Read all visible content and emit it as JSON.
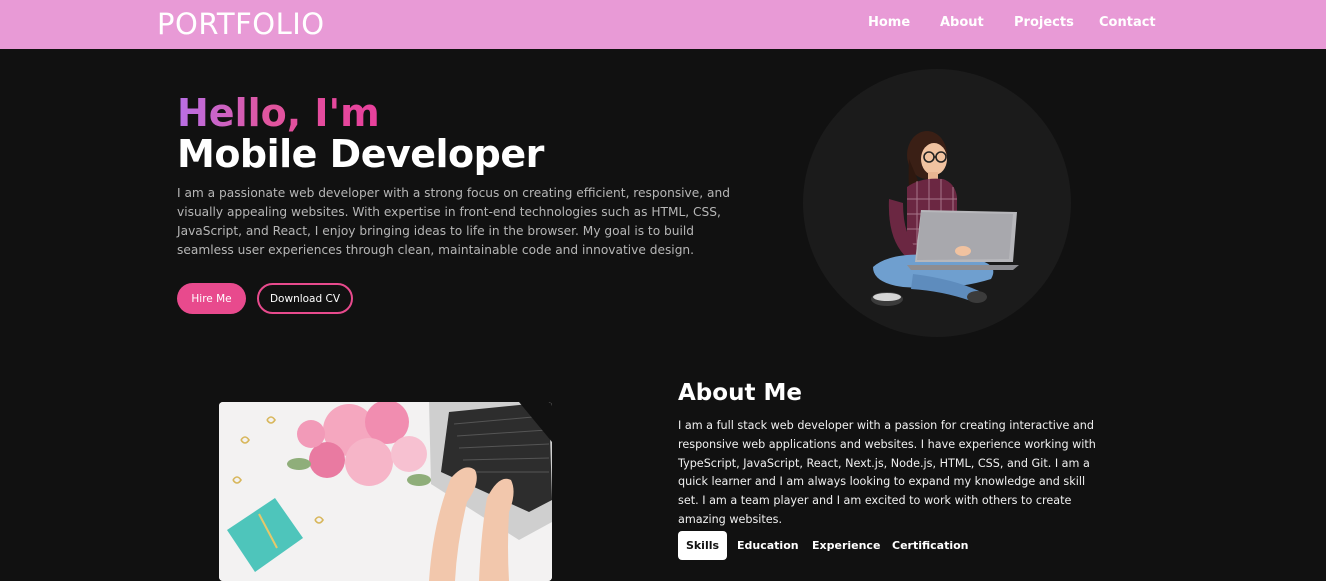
{
  "nav": {
    "logo": "PORTFOLIO",
    "links": [
      "Home",
      "About",
      "Projects",
      "Contact"
    ]
  },
  "hero": {
    "greeting": "Hello, I'm",
    "role": "Mobile Developer",
    "description": "I am a passionate web developer with a strong focus on creating efficient, responsive, and visually appealing websites. With expertise in front-end technologies such as HTML, CSS, JavaScript, and React, I enjoy bringing ideas to life in the browser. My goal is to build seamless user experiences through clean, maintainable code and innovative design.",
    "hire_label": "Hire Me",
    "cv_label": "Download CV"
  },
  "about": {
    "title": "About Me",
    "text": "I am a full stack web developer with a passion for creating interactive and responsive web applications and websites. I have experience working with TypeScript, JavaScript, React, Next.js, Node.js, HTML, CSS, and Git. I am a quick learner and I am always looking to expand my knowledge and skill set. I am a team player and I am excited to work with others to create amazing websites.",
    "tabs": [
      "Skills",
      "Education",
      "Experience",
      "Certification"
    ]
  },
  "colors": {
    "navbar": "#e89ad6",
    "background": "#111111",
    "accent": "#e84a8d",
    "gradient_start": "#b86fe6"
  }
}
